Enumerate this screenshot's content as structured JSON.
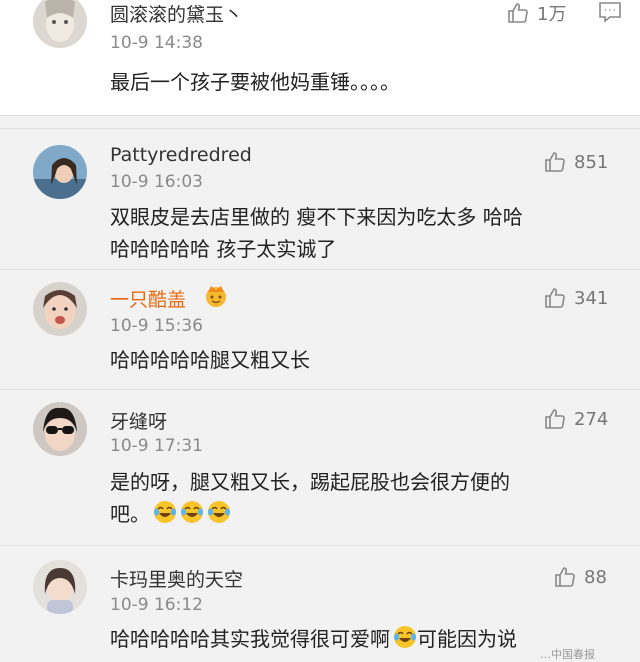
{
  "comments": [
    {
      "username": "圆滚滚的黛玉丶",
      "timestamp": "10-9 14:38",
      "likes": "1万",
      "text_lines": [
        "最后一个孩子要被他妈重锤。。。。"
      ]
    },
    {
      "username": "Pattyredredred",
      "timestamp": "10-9 16:03",
      "likes": "851",
      "text_lines": [
        "双眼皮是去店里做的 瘦不下来因为吃太多 哈哈",
        "哈哈哈哈哈 孩子太实诚了"
      ]
    },
    {
      "username": "一只酷盖",
      "username_color": "#e86b10",
      "timestamp": "10-9 15:36",
      "likes": "341",
      "text_lines": [
        "哈哈哈哈哈腿又粗又长"
      ]
    },
    {
      "username": "牙缝呀",
      "timestamp": "10-9 17:31",
      "likes": "274",
      "text_lines": [
        "是的呀，腿又粗又长，踢起屁股也会很方便的",
        "吧。"
      ]
    },
    {
      "username": "卡玛里奥的天空",
      "timestamp": "10-9 16:12",
      "likes": "88",
      "text_lines": [
        "哈哈哈哈哈其实我觉得很可爱啊",
        "可能因为说"
      ]
    }
  ],
  "icons": {
    "like": "thumbs-up-icon",
    "reply": "comment-bubble-icon",
    "laugh": "laughing-tears-emoji",
    "badge": "crown-badge-icon"
  },
  "colors": {
    "username_special": "#e86b10",
    "background": "#f2f2f2",
    "first_card": "#ffffff"
  },
  "watermark": "…中国春报"
}
